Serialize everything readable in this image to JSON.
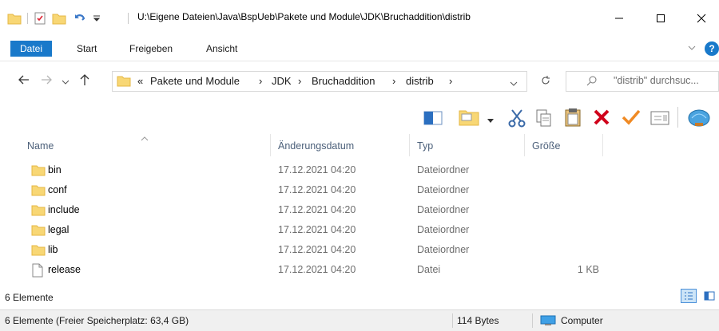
{
  "window": {
    "title": "U:\\Eigene Dateien\\Java\\BspUeb\\Pakete und Module\\JDK\\Bruchaddition\\distrib"
  },
  "ribbon": {
    "tabs": [
      "Datei",
      "Start",
      "Freigeben",
      "Ansicht"
    ]
  },
  "address": {
    "overflow": "«",
    "crumbs": [
      "Pakete und Module",
      "JDK",
      "Bruchaddition",
      "distrib"
    ]
  },
  "search": {
    "placeholder": "\"distrib\" durchsuc..."
  },
  "columns": {
    "name": "Name",
    "date": "Änderungsdatum",
    "type": "Typ",
    "size": "Größe"
  },
  "files": [
    {
      "name": "bin",
      "date": "17.12.2021 04:20",
      "type": "Dateiordner",
      "size": "",
      "kind": "folder"
    },
    {
      "name": "conf",
      "date": "17.12.2021 04:20",
      "type": "Dateiordner",
      "size": "",
      "kind": "folder"
    },
    {
      "name": "include",
      "date": "17.12.2021 04:20",
      "type": "Dateiordner",
      "size": "",
      "kind": "folder"
    },
    {
      "name": "legal",
      "date": "17.12.2021 04:20",
      "type": "Dateiordner",
      "size": "",
      "kind": "folder"
    },
    {
      "name": "lib",
      "date": "17.12.2021 04:20",
      "type": "Dateiordner",
      "size": "",
      "kind": "folder"
    },
    {
      "name": "release",
      "date": "17.12.2021 04:20",
      "type": "Datei",
      "size": "1 KB",
      "kind": "file"
    }
  ],
  "status": {
    "count": "6 Elemente",
    "free_space": "6 Elemente (Freier Speicherplatz: 63,4 GB)",
    "bytes": "114 Bytes",
    "location": "Computer"
  },
  "colors": {
    "accent": "#1979ca",
    "folder": "#f8d775",
    "folder_dark": "#e4b744",
    "delete_red": "#d0021b",
    "check_orange": "#f08a24"
  }
}
